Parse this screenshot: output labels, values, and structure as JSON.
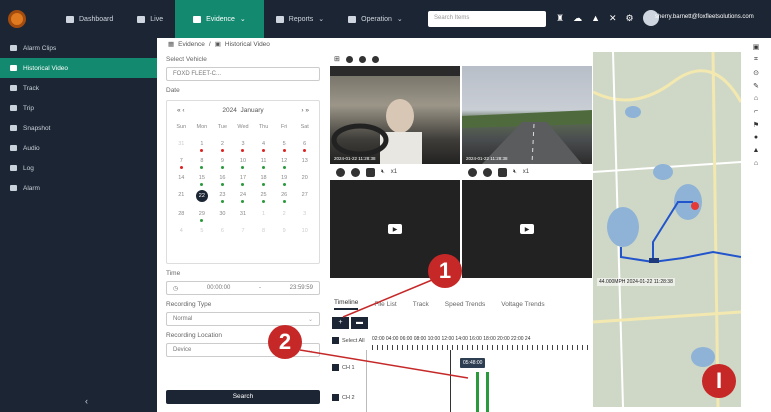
{
  "topbar": {
    "nav": [
      {
        "label": "Dashboard",
        "active": false
      },
      {
        "label": "Live",
        "active": false
      },
      {
        "label": "Evidence",
        "active": true
      },
      {
        "label": "Reports",
        "active": false
      },
      {
        "label": "Operation",
        "active": false
      }
    ],
    "search_placeholder": "Search Items",
    "email": "sherry.barnett@foxfleetsolutions.com",
    "accent": "#138a6f",
    "bg": "#1c2533"
  },
  "sidebar": {
    "items": [
      {
        "label": "Alarm Clips",
        "icon": "film-icon",
        "active": false
      },
      {
        "label": "Historical Video",
        "icon": "video-icon",
        "active": true
      },
      {
        "label": "Track",
        "icon": "route-icon",
        "active": false
      },
      {
        "label": "Trip",
        "icon": "trip-icon",
        "active": false
      },
      {
        "label": "Snapshot",
        "icon": "image-icon",
        "active": false
      },
      {
        "label": "Audio",
        "icon": "audio-icon",
        "active": false
      },
      {
        "label": "Log",
        "icon": "log-icon",
        "active": false
      },
      {
        "label": "Alarm",
        "icon": "alarm-icon",
        "active": false
      }
    ],
    "collapse": "‹"
  },
  "breadcrumb": {
    "root": "Evidence",
    "sep": "/",
    "current": "Historical Video"
  },
  "form": {
    "vehicle_label": "Select Vehicle",
    "vehicle_value": "FOXD FLEET-C...",
    "date_label": "Date",
    "calendar": {
      "prev": "« ‹",
      "year": "2024",
      "month": "January",
      "next": "› »",
      "weekdays": [
        "Sun",
        "Mon",
        "Tue",
        "Wed",
        "Thu",
        "Fri",
        "Sat"
      ],
      "days": [
        "31",
        "1",
        "2",
        "3",
        "4",
        "5",
        "6",
        "7",
        "8",
        "9",
        "10",
        "11",
        "12",
        "13",
        "14",
        "15",
        "16",
        "17",
        "18",
        "19",
        "20",
        "21",
        "22",
        "23",
        "24",
        "25",
        "26",
        "27",
        "28",
        "29",
        "30",
        "31",
        "1",
        "2",
        "3",
        "4",
        "5",
        "6",
        "7",
        "8",
        "9",
        "10"
      ]
    },
    "time_label": "Time",
    "time_start": "00:00:00",
    "time_sep": "-",
    "time_end": "23:59:59",
    "rectype_label": "Recording Type",
    "rectype_value": "Normal",
    "recloc_label": "Recording Location",
    "recloc_value": "Device",
    "search_button": "Search"
  },
  "video": {
    "cam1_stamp": "2024-01-22 11:28:38",
    "cam2_stamp": "2024-01-22 11:28:38",
    "speed1": "x1",
    "speed2": "x1"
  },
  "tabs": [
    "Timeline",
    "File List",
    "Track",
    "Speed Trends",
    "Voltage Trends"
  ],
  "timeline": {
    "select_all": "Select All",
    "ticks": "02:00 04:00 06:00 08:00 10:00 12:00 14:00 16:00 18:00 20:00 22:00 24",
    "cursor_time": "05:48:00",
    "ch1": "CH 1",
    "ch2": "CH 2"
  },
  "map": {
    "stamp": "44.000MPH 2024-01-22 11:28:38"
  },
  "callouts": [
    "1",
    "2",
    "I"
  ]
}
